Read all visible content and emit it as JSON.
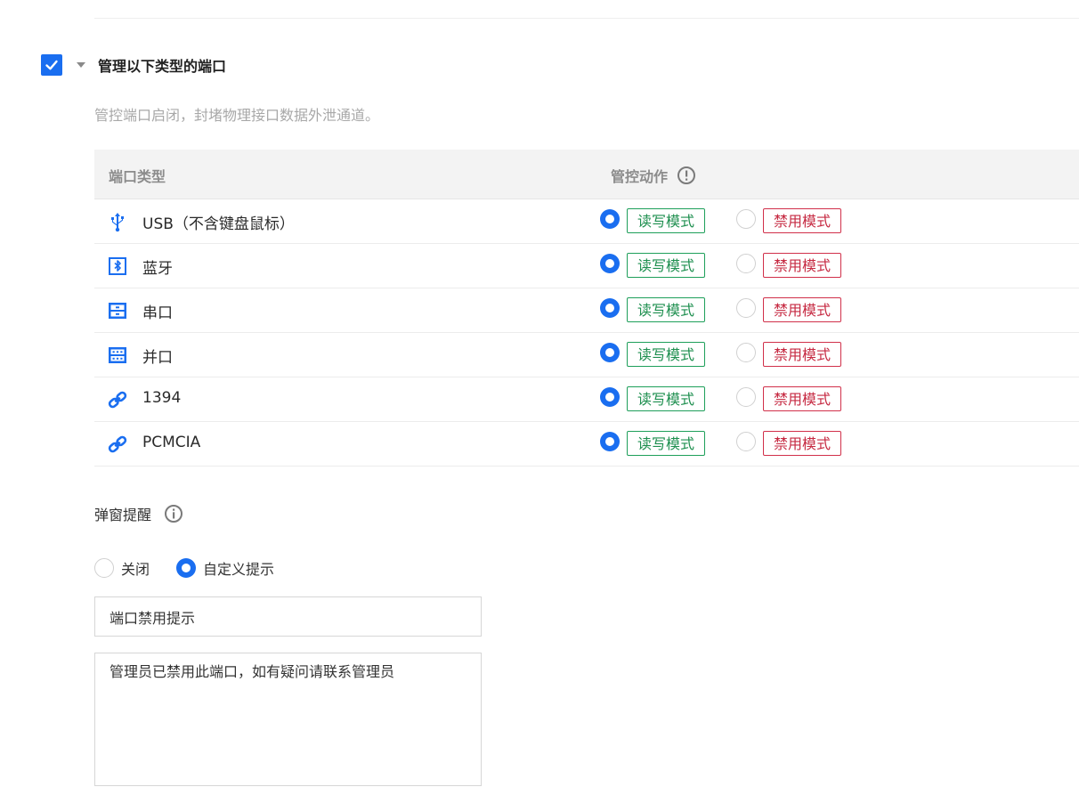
{
  "section": {
    "title": "管理以下类型的端口",
    "description": "管控端口启闭，封堵物理接口数据外泄通道。",
    "checked": true
  },
  "table": {
    "headers": {
      "type": "端口类型",
      "action": "管控动作"
    },
    "rows": [
      {
        "icon": "usb-icon",
        "label": "USB（不含键盘鼠标）",
        "mode": "读写模式",
        "disabled": "禁用模式",
        "selected": "读写模式"
      },
      {
        "icon": "bluetooth-icon",
        "label": "蓝牙",
        "mode": "读写模式",
        "disabled": "禁用模式",
        "selected": "读写模式"
      },
      {
        "icon": "serial-port-icon",
        "label": "串口",
        "mode": "读写模式",
        "disabled": "禁用模式",
        "selected": "读写模式"
      },
      {
        "icon": "parallel-port-icon",
        "label": "并口",
        "mode": "读写模式",
        "disabled": "禁用模式",
        "selected": "读写模式"
      },
      {
        "icon": "link-icon",
        "label": "1394",
        "mode": "读写模式",
        "disabled": "禁用模式",
        "selected": "读写模式"
      },
      {
        "icon": "link-icon",
        "label": "PCMCIA",
        "mode": "读写模式",
        "disabled": "禁用模式",
        "selected": "读写模式"
      }
    ]
  },
  "popup": {
    "label": "弹窗提醒",
    "options": {
      "off": "关闭",
      "custom": "自定义提示"
    },
    "selected": "自定义提示",
    "title_value": "端口禁用提示",
    "message_value": "管理员已禁用此端口，如有疑问请联系管理员"
  },
  "colors": {
    "accent": "#1a6ef0",
    "green": "#1e8f4f",
    "red": "#c62a42"
  }
}
